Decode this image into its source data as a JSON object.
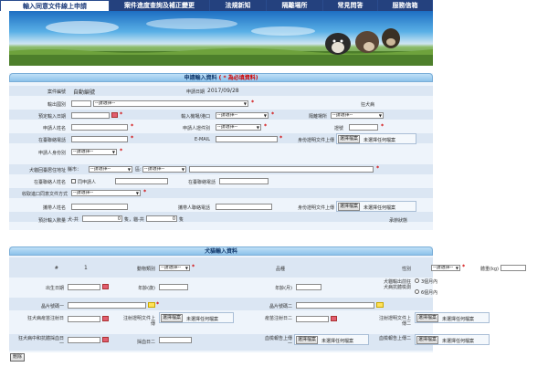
{
  "nav": {
    "tabs": [
      {
        "label": "輸入同意文件線上申請",
        "active": true
      },
      {
        "label": "案件進度查詢及補正變更",
        "active": false
      },
      {
        "label": "法規新知",
        "active": false
      },
      {
        "label": "隔離場所",
        "active": false
      },
      {
        "label": "常見問答",
        "active": false
      },
      {
        "label": "服務信箱",
        "active": false
      }
    ]
  },
  "applicant": {
    "title": "申請輸入資料",
    "required_note": "( * 為必填資料)",
    "case_no_label": "案件編號",
    "case_no_value": "自動編號",
    "apply_date_label": "申請日期",
    "apply_date_value": "2017/09/28",
    "import_type_label": "輸出國別",
    "import_type_select": "--請選擇--",
    "animal_type_label": "狂犬病",
    "expected_date_label": "預定輸入日期",
    "port_label": "輸入機場/港口",
    "port_select": "--請選擇--",
    "quarantine_label": "隔離場所",
    "quarantine_select": "--請選擇--",
    "applicant_name_label": "申請人姓名",
    "applicant_id_type_label": "申請人證件別",
    "applicant_id_type_select": "--請選擇--",
    "passport_label": "證號",
    "phone_label": "在臺聯絡電話",
    "email_label": "E-MAIL",
    "id_doc_label": "身份證明文件上傳",
    "file_button": "選擇檔案",
    "no_file": "未選擇任何檔案",
    "applicant_identity_label": "申請人身份別",
    "identity_select": "--請選擇--",
    "address_label": "犬貓回臺居住地址",
    "city_label": "縣市：",
    "city_select": "--請選擇--",
    "district_label": "區:",
    "district_select": "--請選擇--",
    "importer_name_label": "在臺聯絡人姓名",
    "same_as_applicant": "同申請人",
    "importer_phone_label": "在臺聯絡電話",
    "receive_method_label": "收取進口同意文件方式",
    "receive_select": "--請選擇--",
    "carrier_name_label": "攜帶人姓名",
    "carrier_phone_label": "攜帶人聯絡電話",
    "carrier_id_label": "身份證明文件上傳",
    "qty_label": "預計輸入數量",
    "qty_dog_label": "犬-共",
    "qty_dog_value": "0",
    "qty_dog_unit": "隻，貓-共",
    "qty_cat_value": "0",
    "qty_cat_unit": "隻",
    "status_label": "承辦狀態"
  },
  "animal": {
    "title": "犬貓輸入資料",
    "seq_label": "#",
    "seq_value": "1",
    "species_label": "動物類別",
    "species_select": "--請選擇--",
    "breed_label": "品種",
    "sex_label": "性別",
    "sex_select": "--請選擇--",
    "weight_label": "體重(kg)",
    "birth_label": "出生日期",
    "age_label": "年齡(歲)",
    "age_month_label": "年齡(月)",
    "export_label": "犬貓輸出前狂犬病抗體檢測",
    "radio1": "3個月內",
    "radio2": "6個月內",
    "chip1_label": "晶片號碼一",
    "chip2_label": "晶片號碼二",
    "rabies_date_label": "狂犬病疫苗注射日",
    "vacc_cert_label": "注射證明文件上傳",
    "vacc_date2_label": "疫苗注射日二",
    "vacc_cert2_label": "注射證明文件上傳二",
    "rabies_neutral_label": "狂犬病中和抗體採血日一",
    "blood_date2_label": "採血日二",
    "blood_report_label": "血檢報告上傳一",
    "blood_report2_label": "血檢報告上傳二",
    "file_button": "選擇檔案",
    "no_file": "未選擇任何檔案",
    "delete_button": "刪除"
  },
  "colors": {
    "nav_bg": "#24417e",
    "panel_bg": "#eef4fb",
    "required": "#d10000"
  }
}
